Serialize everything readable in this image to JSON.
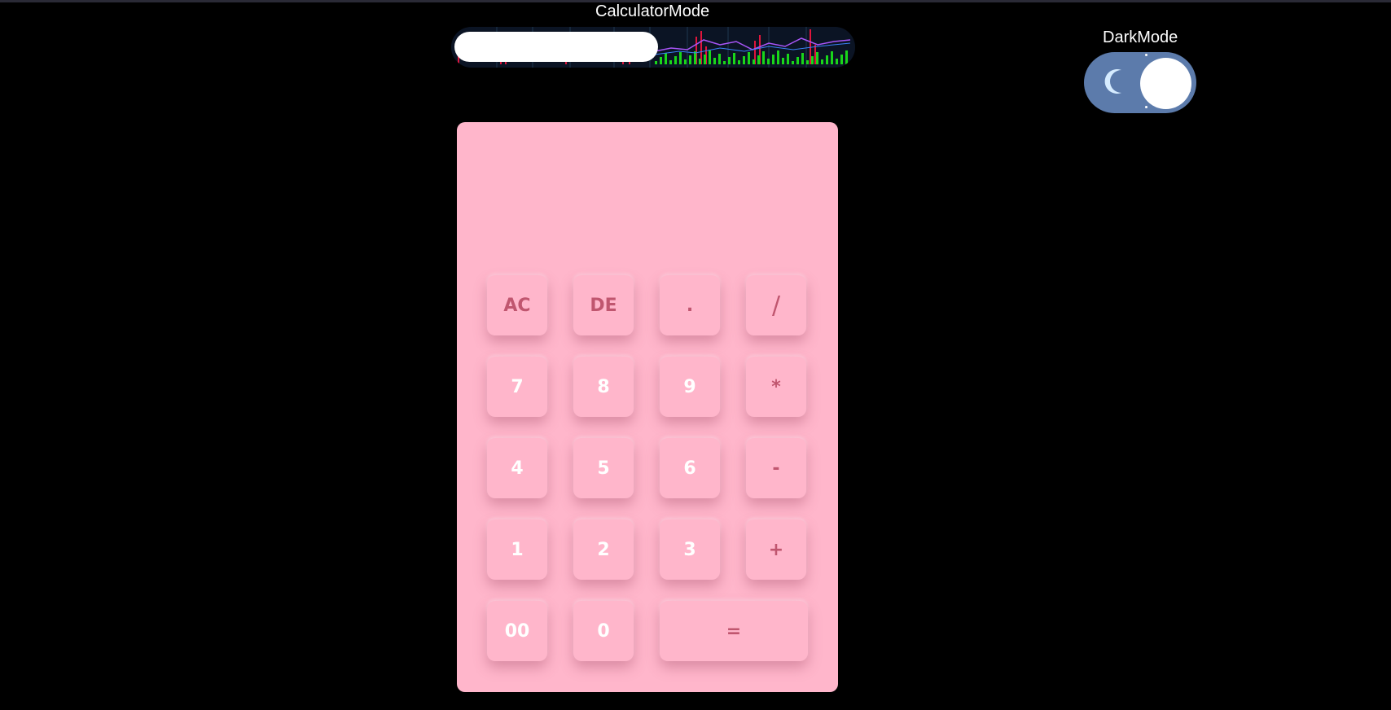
{
  "header": {
    "calculator_mode_label": "CalculatorMode",
    "dark_mode_label": "DarkMode"
  },
  "calculator": {
    "display_value": "",
    "keys": {
      "ac": "AC",
      "de": "DE",
      "dot": ".",
      "divide": "/",
      "seven": "7",
      "eight": "8",
      "nine": "9",
      "multiply": "*",
      "four": "4",
      "five": "5",
      "six": "6",
      "minus": "-",
      "one": "1",
      "two": "2",
      "three": "3",
      "plus": "+",
      "double_zero": "00",
      "zero": "0",
      "equals": "="
    }
  },
  "colors": {
    "background": "#000000",
    "calculator_body": "#ffb6cb",
    "operator_text": "#c0566f",
    "digit_text": "#ffffff",
    "dark_toggle_track": "#5c7bab"
  },
  "icons": {
    "dark_toggle": "moon-icon",
    "mode_slider_background": "stock-chart-pattern"
  }
}
